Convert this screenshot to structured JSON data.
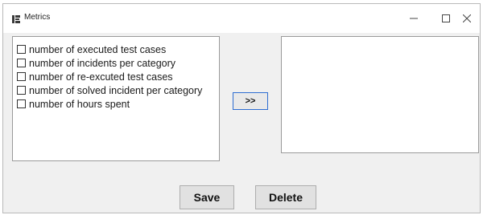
{
  "window": {
    "title": "Metrics",
    "icon": "app-icon",
    "controls": {
      "minimize_icon": "minimize-icon",
      "maximize_icon": "maximize-icon",
      "close_icon": "close-icon"
    }
  },
  "available_metrics": {
    "items": [
      {
        "label": "number of executed test cases",
        "checked": false
      },
      {
        "label": "number of incidents per category",
        "checked": false
      },
      {
        "label": "number of re-excuted test cases",
        "checked": false
      },
      {
        "label": "number of solved incident per category",
        "checked": false
      },
      {
        "label": "number of hours spent",
        "checked": false
      }
    ]
  },
  "selected_metrics": {
    "items": []
  },
  "buttons": {
    "move": ">>",
    "save": "Save",
    "delete": "Delete"
  },
  "colors": {
    "window_bg": "#f0f0f0",
    "titlebar_bg": "#ffffff",
    "focus_border": "#2e6dd1"
  }
}
